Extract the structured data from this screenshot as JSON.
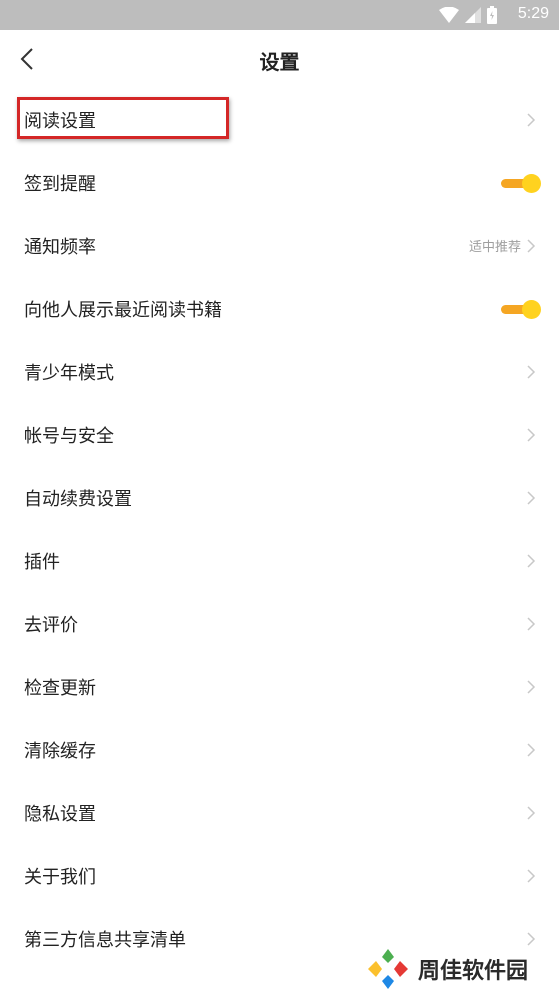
{
  "status_bar": {
    "time": "5:29",
    "bg_color": "#bdbdbd"
  },
  "header": {
    "title": "设置",
    "back_icon": "chevron-left-icon"
  },
  "settings": [
    {
      "label": "阅读设置",
      "control": "chevron",
      "highlighted": true
    },
    {
      "label": "签到提醒",
      "control": "toggle",
      "on": true
    },
    {
      "label": "通知频率",
      "control": "chevron",
      "value": "适中推荐"
    },
    {
      "label": "向他人展示最近阅读书籍",
      "control": "toggle",
      "on": true
    },
    {
      "label": "青少年模式",
      "control": "chevron"
    },
    {
      "label": "帐号与安全",
      "control": "chevron"
    },
    {
      "label": "自动续费设置",
      "control": "chevron"
    },
    {
      "label": "插件",
      "control": "chevron"
    },
    {
      "label": "去评价",
      "control": "chevron"
    },
    {
      "label": "检查更新",
      "control": "chevron"
    },
    {
      "label": "清除缓存",
      "control": "chevron"
    },
    {
      "label": "隐私设置",
      "control": "chevron"
    },
    {
      "label": "关于我们",
      "control": "chevron"
    },
    {
      "label": "第三方信息共享清单",
      "control": "chevron"
    }
  ],
  "watermark": {
    "text": "周佳软件园"
  },
  "colors": {
    "toggle_track": "#f5a623",
    "toggle_knob": "#ffd21f",
    "highlight_border": "#d42727",
    "chevron": "#c8c8c8"
  }
}
